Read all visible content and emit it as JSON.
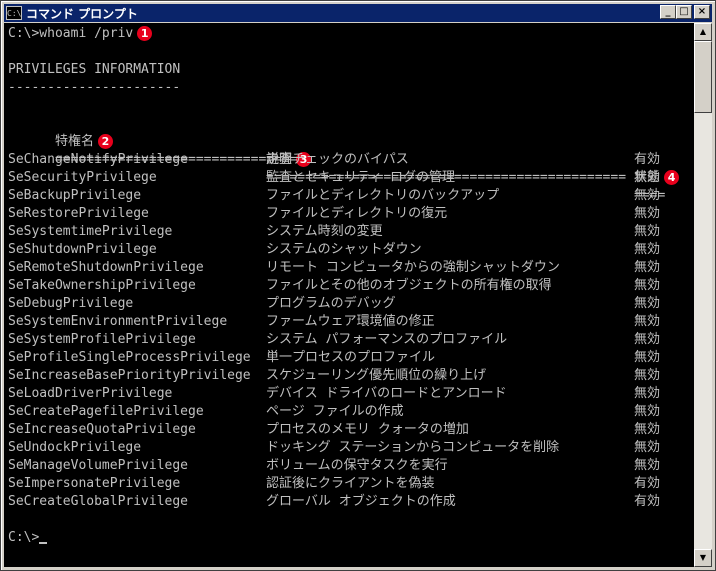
{
  "window": {
    "title": "コマンド プロンプト",
    "icon_label": "C:\\",
    "minimize_glyph": "_",
    "maximize_glyph": "□",
    "close_glyph": "×"
  },
  "console": {
    "command": "C:\\>whoami /priv",
    "header": "PRIVILEGES INFORMATION",
    "header_rule": "----------------------",
    "col_privilege": "特権名",
    "col_description": "説明",
    "col_state": "状態",
    "rule_privilege": "===============================",
    "rule_description": "==============================================",
    "rule_state": "====",
    "rows": [
      {
        "name": "SeChangeNotifyPrivilege",
        "desc": "走査チェックのバイパス",
        "state": "有効"
      },
      {
        "name": "SeSecurityPrivilege",
        "desc": "監査とセキュリティ ログの管理",
        "state": "無効"
      },
      {
        "name": "SeBackupPrivilege",
        "desc": "ファイルとディレクトリのバックアップ",
        "state": "無効"
      },
      {
        "name": "SeRestorePrivilege",
        "desc": "ファイルとディレクトリの復元",
        "state": "無効"
      },
      {
        "name": "SeSystemtimePrivilege",
        "desc": "システム時刻の変更",
        "state": "無効"
      },
      {
        "name": "SeShutdownPrivilege",
        "desc": "システムのシャットダウン",
        "state": "無効"
      },
      {
        "name": "SeRemoteShutdownPrivilege",
        "desc": "リモート コンピュータからの強制シャットダウン",
        "state": "無効"
      },
      {
        "name": "SeTakeOwnershipPrivilege",
        "desc": "ファイルとその他のオブジェクトの所有権の取得",
        "state": "無効"
      },
      {
        "name": "SeDebugPrivilege",
        "desc": "プログラムのデバッグ",
        "state": "無効"
      },
      {
        "name": "SeSystemEnvironmentPrivilege",
        "desc": "ファームウェア環境値の修正",
        "state": "無効"
      },
      {
        "name": "SeSystemProfilePrivilege",
        "desc": "システム パフォーマンスのプロファイル",
        "state": "無効"
      },
      {
        "name": "SeProfileSingleProcessPrivilege",
        "desc": "単一プロセスのプロファイル",
        "state": "無効"
      },
      {
        "name": "SeIncreaseBasePriorityPrivilege",
        "desc": "スケジューリング優先順位の繰り上げ",
        "state": "無効"
      },
      {
        "name": "SeLoadDriverPrivilege",
        "desc": "デバイス ドライバのロードとアンロード",
        "state": "無効"
      },
      {
        "name": "SeCreatePagefilePrivilege",
        "desc": "ページ ファイルの作成",
        "state": "無効"
      },
      {
        "name": "SeIncreaseQuotaPrivilege",
        "desc": "プロセスのメモリ クォータの増加",
        "state": "無効"
      },
      {
        "name": "SeUndockPrivilege",
        "desc": "ドッキング ステーションからコンピュータを削除",
        "state": "無効"
      },
      {
        "name": "SeManageVolumePrivilege",
        "desc": "ボリュームの保守タスクを実行",
        "state": "無効"
      },
      {
        "name": "SeImpersonatePrivilege",
        "desc": "認証後にクライアントを偽装",
        "state": "有効"
      },
      {
        "name": "SeCreateGlobalPrivilege",
        "desc": "グローバル オブジェクトの作成",
        "state": "有効"
      }
    ],
    "prompt": "C:\\>"
  },
  "markers": [
    "1",
    "2",
    "3",
    "4"
  ],
  "scrollbar": {
    "up_glyph": "▲",
    "down_glyph": "▼"
  }
}
